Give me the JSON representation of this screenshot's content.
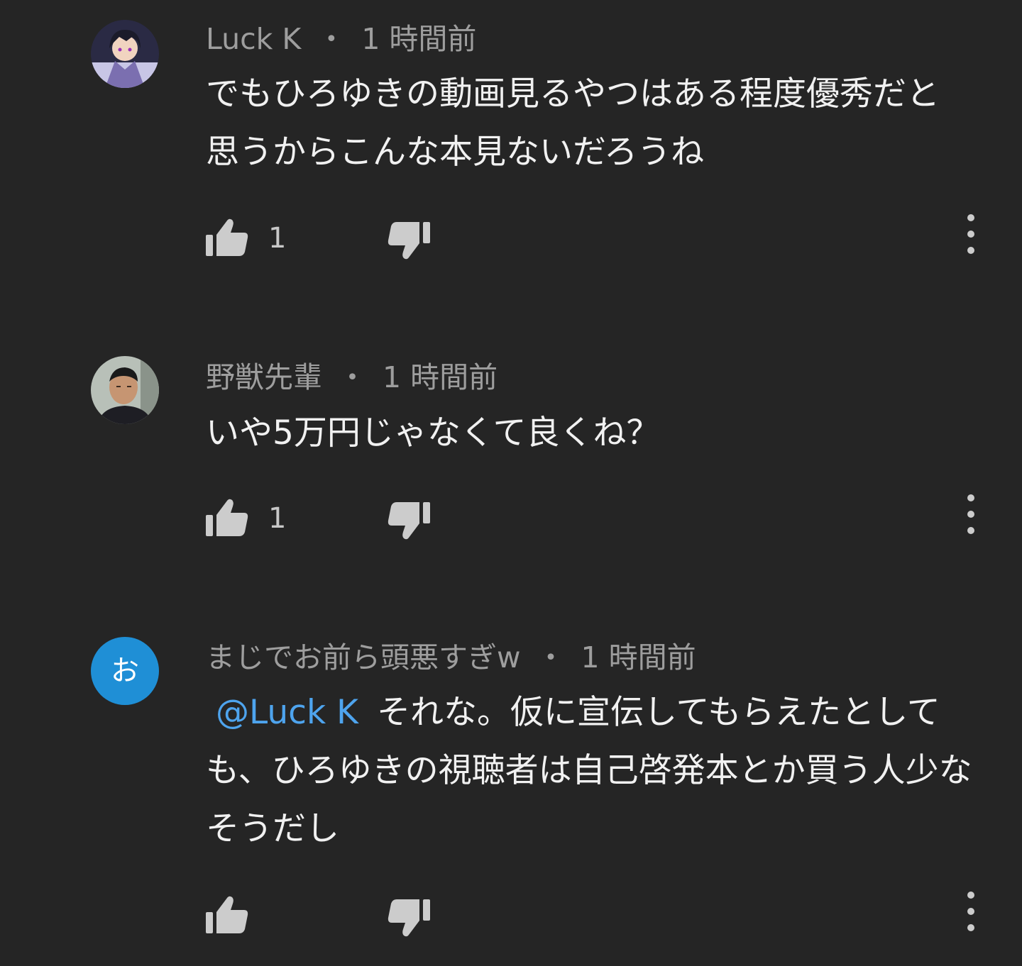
{
  "comments": [
    {
      "author": "Luck K",
      "separator": "・",
      "time": "1 時間前",
      "mention": "",
      "text": "でもひろゆきの動画見るやつはある程度優秀だと思うからこんな本見ないだろうね",
      "like_count": "1",
      "avatar": "anime-character-avatar"
    },
    {
      "author": "野獣先輩",
      "separator": "・",
      "time": "1 時間前",
      "mention": "",
      "text": "いや5万円じゃなくて良くね？",
      "like_count": "1",
      "avatar": "person-photo-avatar"
    },
    {
      "author": "まじでお前ら頭悪すぎw",
      "separator": "・",
      "time": "1 時間前",
      "mention": "@Luck K",
      "text": "それな。仮に宣伝してもらえたとしても、ひろゆきの視聴者は自己啓発本とか買う人少なそうだし",
      "like_count": "",
      "avatar_letter": "お",
      "avatar_color": "#1f8fd6"
    }
  ],
  "colors": {
    "background": "#252525",
    "text": "#f1f1f1",
    "meta_text": "#9e9e9e",
    "icon": "#cccccc",
    "mention": "#4ea4ee"
  },
  "icons": [
    "thumb-up-icon",
    "thumb-down-icon",
    "more-vert-icon"
  ]
}
